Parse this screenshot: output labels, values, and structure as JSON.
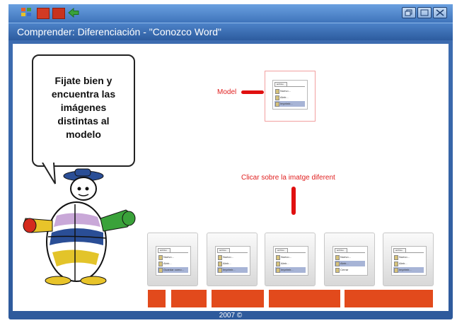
{
  "window": {
    "title": "Comprender: Diferenciación - \"Conozco Word\"",
    "footer": "2007 ©"
  },
  "toolbar": {
    "icons": [
      "grid-icon",
      "red-folder-icon",
      "red-book-icon",
      "back-arrow-icon"
    ],
    "window_buttons": [
      "restore-icon",
      "maximize-icon",
      "close-icon"
    ]
  },
  "bubble": {
    "text": "Fijate bien y encuentra las imágenes distintas al modelo"
  },
  "model": {
    "label": "Model"
  },
  "instruction": "Clicar sobre la imatge diferent",
  "menu_tab": "archivo",
  "options": [
    {
      "rows": [
        "Nuevo...",
        "Abrir...",
        "Guardar como..."
      ],
      "selected": 2
    },
    {
      "rows": [
        "Nuevo...",
        "Abrir...",
        "Imprimir..."
      ],
      "selected": 2
    },
    {
      "rows": [
        "Nuevo...",
        "Abrir...",
        "Imprimir..."
      ],
      "selected": 2
    },
    {
      "rows": [
        "Nuevo...",
        "Abrir...",
        "Cerrar"
      ],
      "selected": 1
    },
    {
      "rows": [
        "Nuevo...",
        "Abrir...",
        "Imprimir..."
      ],
      "selected": 2
    }
  ],
  "model_rows": [
    "Nuevo...",
    "Abrir...",
    "Imprimir..."
  ],
  "colors": {
    "accent_red": "#e01010",
    "answer_orange": "#e24a1c",
    "window_blue": "#2e5a9c"
  }
}
